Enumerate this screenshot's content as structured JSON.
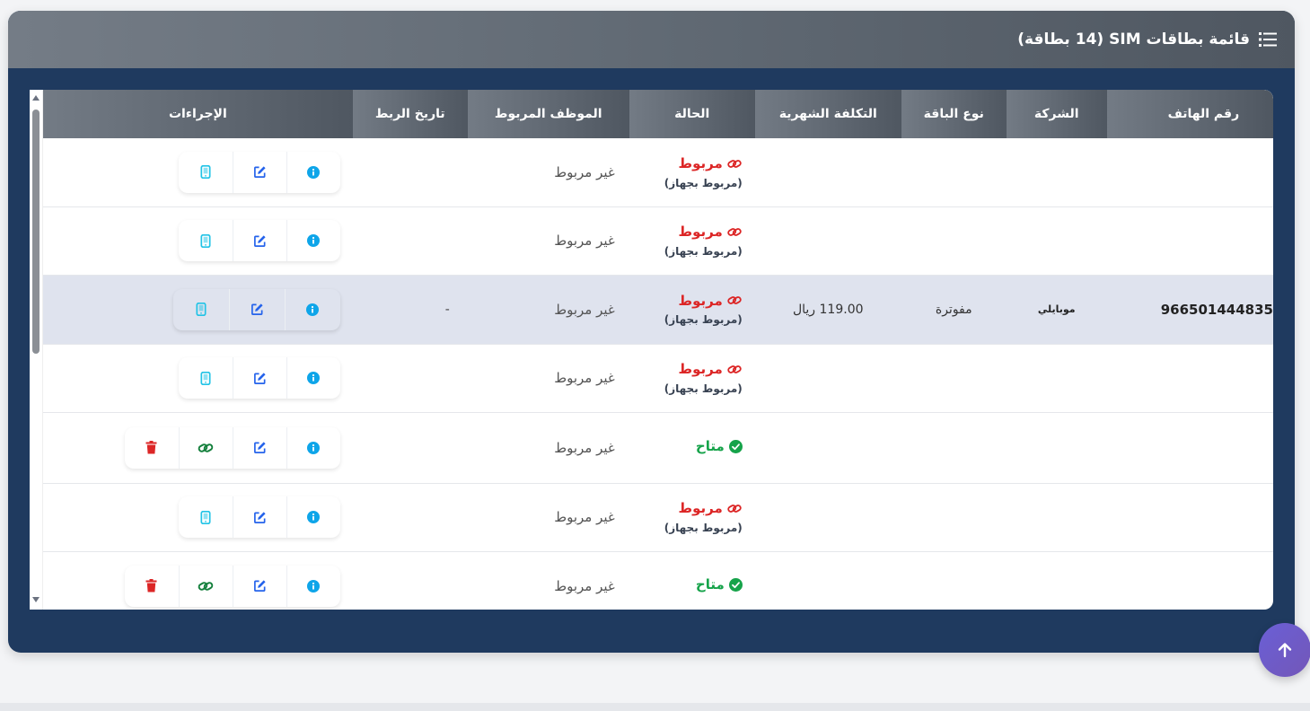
{
  "card": {
    "title": "قائمة بطاقات SIM (14 بطاقة)",
    "icon": "list-icon"
  },
  "table": {
    "headers": {
      "phone": "رقم الهاتف",
      "company": "الشركة",
      "plan": "نوع الباقة",
      "cost": "التكلفة الشهرية",
      "status": "الحالة",
      "employee": "الموظف المربوط",
      "date": "تاريخ الربط",
      "actions": "الإجراءات"
    },
    "rows": [
      {
        "phone": "",
        "company": "",
        "plan": "",
        "cost": "",
        "status": "مربوط",
        "status_sub": "(مربوط بجهاز)",
        "employee": "غير مربوط",
        "date": ""
      },
      {
        "phone": "",
        "company": "",
        "plan": "",
        "cost": "",
        "status": "مربوط",
        "status_sub": "(مربوط بجهاز)",
        "employee": "غير مربوط",
        "date": ""
      },
      {
        "phone": "966501444835",
        "company": "موبايلي",
        "plan": "مفوترة",
        "cost": "119.00 ريال",
        "status": "مربوط",
        "status_sub": "(مربوط بجهاز)",
        "employee": "غير مربوط",
        "date": "-"
      },
      {
        "phone": "",
        "company": "",
        "plan": "",
        "cost": "",
        "status": "مربوط",
        "status_sub": "(مربوط بجهاز)",
        "employee": "غير مربوط",
        "date": ""
      },
      {
        "phone": "",
        "company": "",
        "plan": "",
        "cost": "",
        "status": "متاح",
        "status_sub": "",
        "employee": "غير مربوط",
        "date": ""
      },
      {
        "phone": "",
        "company": "",
        "plan": "",
        "cost": "",
        "status": "مربوط",
        "status_sub": "(مربوط بجهاز)",
        "employee": "غير مربوط",
        "date": ""
      },
      {
        "phone": "",
        "company": "",
        "plan": "",
        "cost": "",
        "status": "متاح",
        "status_sub": "",
        "employee": "غير مربوط",
        "date": ""
      }
    ]
  },
  "colors": {
    "linked": "#dc2626",
    "available": "#16a34a",
    "info": "#0ea5e9",
    "edit": "#2563eb",
    "device": "#22c3e6",
    "link": "#15803d",
    "delete": "#dc2626"
  }
}
